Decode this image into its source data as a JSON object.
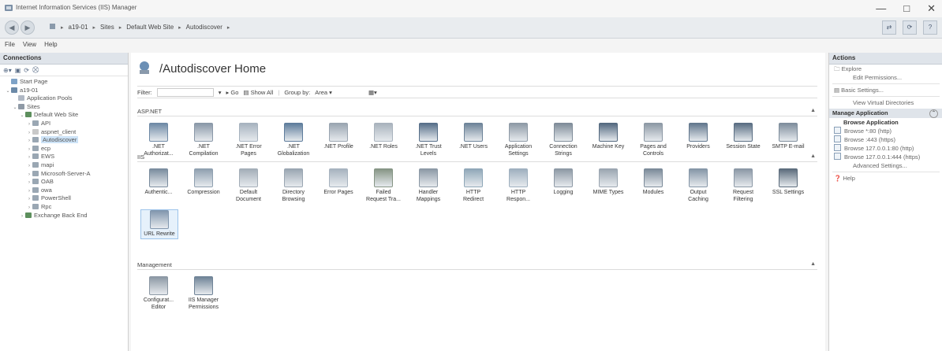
{
  "window": {
    "title": "Internet Information Services (IIS) Manager",
    "controls": {
      "minimize": "—",
      "restore": "□",
      "close": "✕"
    }
  },
  "address": {
    "back": "◀",
    "forward": "▶",
    "crumbs": [
      "a19-01",
      "Sites",
      "Default Web Site",
      "Autodiscover"
    ]
  },
  "menu": [
    "File",
    "View",
    "Help"
  ],
  "connections": {
    "title": "Connections",
    "tree": [
      {
        "label": "Start Page",
        "depth": 0,
        "twisty": "",
        "icon": "start-page-icon",
        "color": "#7fa3c7"
      },
      {
        "label": "a19-01",
        "depth": 0,
        "twisty": "⌄",
        "icon": "server-icon",
        "color": "#6c8aa8"
      },
      {
        "label": "Application Pools",
        "depth": 1,
        "twisty": "",
        "icon": "app-pool-icon",
        "color": "#b0b8c4"
      },
      {
        "label": "Sites",
        "depth": 1,
        "twisty": "⌄",
        "icon": "sites-icon",
        "color": "#8f9aa6"
      },
      {
        "label": "Default Web Site",
        "depth": 2,
        "twisty": "⌄",
        "icon": "globe-icon",
        "color": "#5d8f5d"
      },
      {
        "label": "API",
        "depth": 3,
        "twisty": "›",
        "icon": "app-icon",
        "color": "#9aa7b3"
      },
      {
        "label": "aspnet_client",
        "depth": 3,
        "twisty": "›",
        "icon": "folder-icon",
        "color": "#c9c9c9"
      },
      {
        "label": "Autodiscover",
        "depth": 3,
        "twisty": "›",
        "icon": "app-icon",
        "color": "#9aa7b3",
        "selected": true
      },
      {
        "label": "ecp",
        "depth": 3,
        "twisty": "›",
        "icon": "app-icon",
        "color": "#9aa7b3"
      },
      {
        "label": "EWS",
        "depth": 3,
        "twisty": "›",
        "icon": "app-icon",
        "color": "#9aa7b3"
      },
      {
        "label": "mapi",
        "depth": 3,
        "twisty": "›",
        "icon": "app-icon",
        "color": "#9aa7b3"
      },
      {
        "label": "Microsoft-Server-A",
        "depth": 3,
        "twisty": "›",
        "icon": "app-icon",
        "color": "#9aa7b3"
      },
      {
        "label": "OAB",
        "depth": 3,
        "twisty": "›",
        "icon": "app-icon",
        "color": "#9aa7b3"
      },
      {
        "label": "owa",
        "depth": 3,
        "twisty": "›",
        "icon": "app-icon",
        "color": "#9aa7b3"
      },
      {
        "label": "PowerShell",
        "depth": 3,
        "twisty": "›",
        "icon": "app-icon",
        "color": "#9aa7b3"
      },
      {
        "label": "Rpc",
        "depth": 3,
        "twisty": "›",
        "icon": "app-icon",
        "color": "#9aa7b3"
      },
      {
        "label": "Exchange Back End",
        "depth": 2,
        "twisty": "›",
        "icon": "globe-icon",
        "color": "#5d8f5d"
      }
    ]
  },
  "center": {
    "title": "/Autodiscover Home",
    "filter": {
      "label": "Filter:",
      "go": "Go",
      "show_all": "Show All",
      "group_by_label": "Group by:",
      "group_by_value": "Area"
    },
    "sections": [
      {
        "name": "ASP.NET",
        "items": [
          {
            "label": ".NET Authorizat...",
            "color": "#6f8aa6"
          },
          {
            "label": ".NET Compilation",
            "color": "#8a98a8"
          },
          {
            "label": ".NET Error Pages",
            "color": "#a7b3bf"
          },
          {
            "label": ".NET Globalization",
            "color": "#5f7d9c"
          },
          {
            "label": ".NET Profile",
            "color": "#9aa5b1"
          },
          {
            "label": ".NET Roles",
            "color": "#a9b3bd"
          },
          {
            "label": ".NET Trust Levels",
            "color": "#58708a"
          },
          {
            "label": ".NET Users",
            "color": "#6e8499"
          },
          {
            "label": "Application Settings",
            "color": "#8e9aa6"
          },
          {
            "label": "Connection Strings",
            "color": "#7f8c99"
          },
          {
            "label": "Machine Key",
            "color": "#556a80"
          },
          {
            "label": "Pages and Controls",
            "color": "#8d99a5"
          },
          {
            "label": "Providers",
            "color": "#63788e"
          },
          {
            "label": "Session State",
            "color": "#5a6e83"
          },
          {
            "label": "SMTP E-mail",
            "color": "#7f8e9d"
          }
        ]
      },
      {
        "name": "IIS",
        "items": [
          {
            "label": "Authentic...",
            "color": "#7a8c9e"
          },
          {
            "label": "Compression",
            "color": "#8fa0b0"
          },
          {
            "label": "Default Document",
            "color": "#a4aeb8"
          },
          {
            "label": "Directory Browsing",
            "color": "#9aa6b2"
          },
          {
            "label": "Error Pages",
            "color": "#a7b3bf"
          },
          {
            "label": "Failed Request Tra...",
            "color": "#869585"
          },
          {
            "label": "Handler Mappings",
            "color": "#8c99a6"
          },
          {
            "label": "HTTP Redirect",
            "color": "#8fa7b8"
          },
          {
            "label": "HTTP Respon...",
            "color": "#9fb0bf"
          },
          {
            "label": "Logging",
            "color": "#8d99a5"
          },
          {
            "label": "MIME Types",
            "color": "#9ba6b1"
          },
          {
            "label": "Modules",
            "color": "#7b8a99"
          },
          {
            "label": "Output Caching",
            "color": "#8596a7"
          },
          {
            "label": "Request Filtering",
            "color": "#8b98a6"
          },
          {
            "label": "SSL Settings",
            "color": "#5c6c7c"
          },
          {
            "label": "URL Rewrite",
            "color": "#8297ae",
            "selected": true
          }
        ]
      },
      {
        "name": "Management",
        "items": [
          {
            "label": "Configurat... Editor",
            "color": "#8c98a4"
          },
          {
            "label": "IIS Manager Permissions",
            "color": "#6f8397"
          }
        ]
      }
    ]
  },
  "actions": {
    "title": "Actions",
    "top": [
      {
        "label": "Explore",
        "icon": "explore-icon"
      },
      {
        "label": "Edit Permissions...",
        "sub": true
      }
    ],
    "basic": "Basic Settings...",
    "virtual": "View Virtual Directories",
    "manage_title": "Manage Application",
    "browse_title": "Browse Application",
    "browse": [
      "Browse *:80 (http)",
      "Browse :443 (https)",
      "Browse 127.0.0.1:80 (http)",
      "Browse 127.0.0.1:444 (https)"
    ],
    "advanced": "Advanced Settings...",
    "help": "Help"
  }
}
